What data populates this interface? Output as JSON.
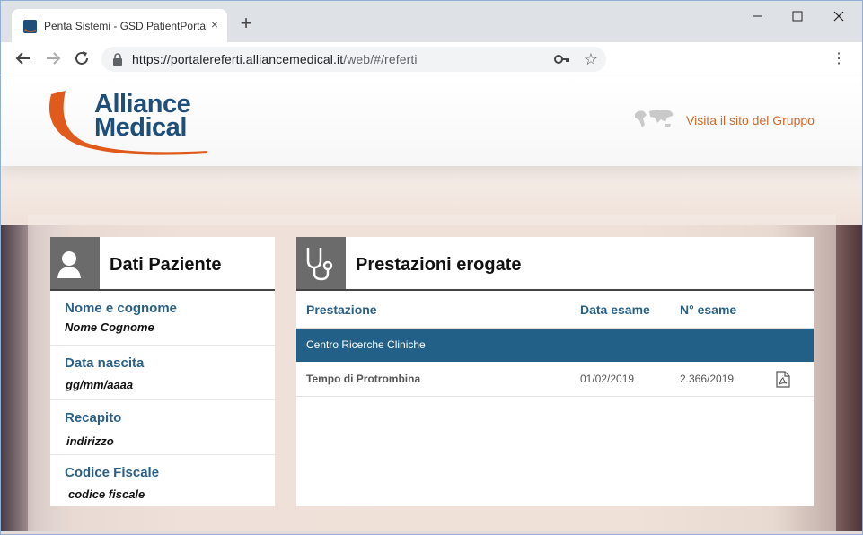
{
  "browser": {
    "tab_title": "Penta Sistemi - GSD.PatientPortal",
    "tab_close": "×",
    "new_tab": "+",
    "url_host": "https://portalereferti.alliancemedical.it",
    "url_path": "/web/#/referti",
    "menu": "⋮",
    "star": "☆"
  },
  "header": {
    "logo_line1": "Alliance",
    "logo_line2": "Medical",
    "visit_link": "Visita il sito del Gruppo",
    "brand_color": "#1f4e79",
    "accent_color": "#d2692a"
  },
  "patient_card": {
    "title": "Dati Paziente",
    "fields": [
      {
        "label": "Nome e cognome",
        "value": "Nome Cognome"
      },
      {
        "label": "Data nascita",
        "value": "gg/mm/aaaa"
      },
      {
        "label": "Recapito",
        "value": "indirizzo"
      },
      {
        "label": "Codice Fiscale",
        "value": "codice fiscale"
      }
    ]
  },
  "services_card": {
    "title": "Prestazioni erogate",
    "columns": [
      "Prestazione",
      "Data esame",
      "N° esame"
    ],
    "groups": [
      {
        "name": "Centro Ricerche Cliniche",
        "rows": [
          {
            "prestazione": "Tempo di Protrombina",
            "data_esame": "01/02/2019",
            "n_esame": "2.366/2019",
            "icon": "pdf-icon"
          }
        ]
      }
    ],
    "group_color": "#236087"
  }
}
